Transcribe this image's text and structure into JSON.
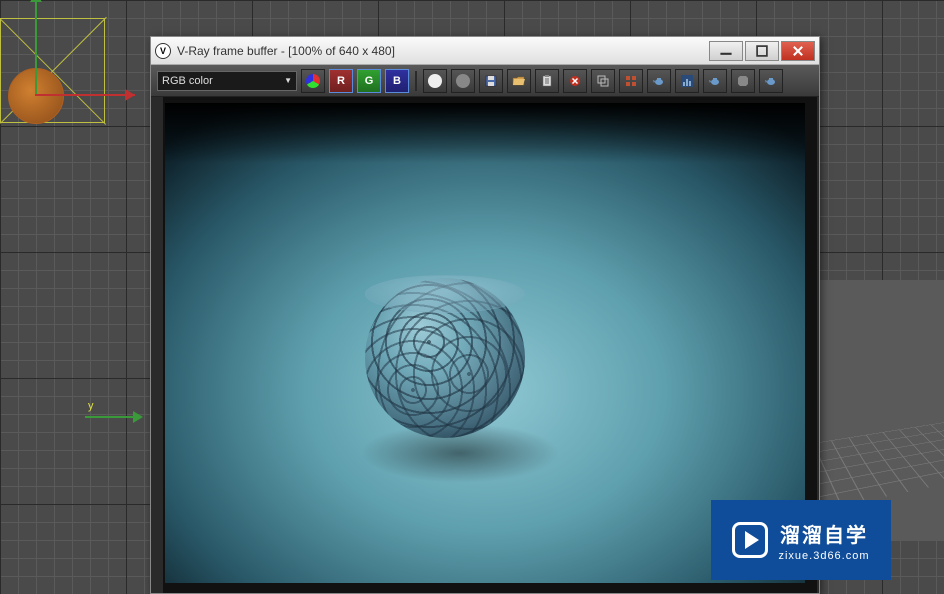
{
  "window": {
    "title": "V-Ray frame buffer - [100% of 640 x 480]",
    "icon_label": "V"
  },
  "channel_select": {
    "value": "RGB color"
  },
  "toolbar": {
    "rgb_btn_title": "RGB",
    "r_label": "R",
    "g_label": "G",
    "b_label": "B"
  },
  "icons": {
    "rgb": "rgb-channels",
    "red": "red-channel",
    "green": "green-channel",
    "blue": "blue-channel",
    "mono_white": "mono-white",
    "mono_gray": "mono-gray",
    "save": "save",
    "open": "open-folder",
    "clipboard": "clipboard",
    "clear": "clear-delete",
    "duplicate": "duplicate",
    "region": "region-render",
    "teapot1": "render-teapot",
    "histogram": "histogram",
    "teapot2": "render-last",
    "stop": "stop",
    "teapot3": "render-settings"
  },
  "axes": {
    "y_label": "y"
  },
  "watermark": {
    "line1": "溜溜自学",
    "line2": "zixue.3d66.com"
  }
}
